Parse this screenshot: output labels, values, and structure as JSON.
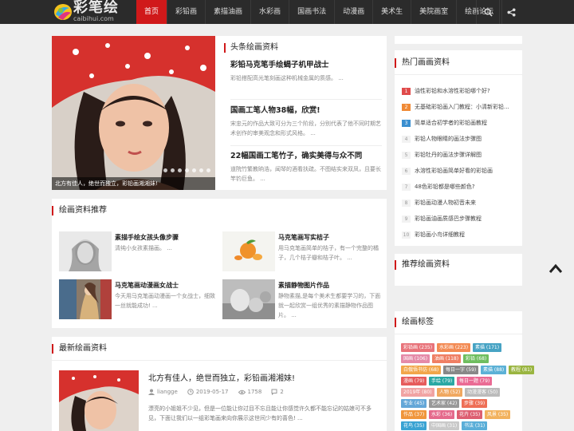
{
  "site": {
    "logo_text": "彩笔绘",
    "logo_sub": "caibihui.com"
  },
  "nav": {
    "items": [
      "首页",
      "彩铅画",
      "素描油画",
      "水彩画",
      "国画书法",
      "动漫画",
      "美术生",
      "美院画室",
      "绘画论坛"
    ],
    "active": 0
  },
  "colors": {
    "topbar": "#2b2b2b",
    "accent": "#d0191a"
  },
  "icons": {
    "search": "search-icon",
    "share": "share-icon",
    "backtop": "chevron-up-icon"
  },
  "headline": {
    "section_title": "头条绘画资料",
    "hero_caption": "北方有佳人，绝世而独立，彩铅画湘湘妹!",
    "items": [
      {
        "title": "彩铅马克笔手绘蝎子机甲战士",
        "desc": "彩铅搭配高光笔刻画这种机械金属的质感。 ..."
      },
      {
        "title": "国画工笔人物38幅，欣赏!",
        "desc": "宋忠元的作品大致可分为三个阶段，分别代表了他不同时期艺术创作的审美观念和形式风格。 ..."
      },
      {
        "title": "22幅国画工笔竹子，确实美得与众不同",
        "desc": "道院竹繁教晌浩，闻琴的酒看扶疏。不图结实来双凤，且要长竿钓巨鱼。 ..."
      }
    ]
  },
  "recommend": {
    "section_title": "绘画资料推荐",
    "items": [
      {
        "title": "素描手绘女孩头像步骤",
        "desc": "清纯小女孩素描画。 ..."
      },
      {
        "title": "马克笔画写实桔子",
        "desc": "用马克笔画简单的桔子，有一个完整的橘子，几个桔子瓣和桔子叶。 ..."
      },
      {
        "title": "马克笔画动漫画女战士",
        "desc": "今天用马克笔画动漫画一个女战士，细致一丝就能成功! ..."
      },
      {
        "title": "素描静物图片作品",
        "desc": "静物素描,是每个美术生都要学习的，下面就一起欣赏一组优秀的素描静物作品图片。 ..."
      }
    ]
  },
  "latest": {
    "section_title": "最新绘画资料",
    "item": {
      "title": "北方有佳人，绝世而独立，彩铅画湘湘妹!",
      "author": "liangge",
      "date": "2019-05-17",
      "views": "1758",
      "comments": "2",
      "desc": "漂亮的小姐姐不少见，但是一位能让你过目不忘且能让你感觉许久都不能忘记的姑娘可不多见，下面让我们以一组彩笔画来向你展示这世间少有的喜色! ..."
    }
  },
  "hot": {
    "section_title": "热门画画资料",
    "items": [
      {
        "rank": "1",
        "title": "油性彩铅和水溶性彩铅哪个好?"
      },
      {
        "rank": "2",
        "title": "无基础彩铅画入门教程：小清新彩铅..."
      },
      {
        "rank": "3",
        "title": "简单适合初学者的彩铅画教程"
      },
      {
        "rank": "4",
        "title": "彩铅人物眼睛的画法步骤图"
      },
      {
        "rank": "5",
        "title": "彩铅牡丹的画法步骤详解图"
      },
      {
        "rank": "6",
        "title": "水溶性彩铅画简单好看的彩铅画"
      },
      {
        "rank": "7",
        "title": "48色彩铅都是哪些颜色?"
      },
      {
        "rank": "8",
        "title": "彩铅画动漫人物初音未来"
      },
      {
        "rank": "9",
        "title": "彩铅画油画质感巴步骤教程"
      },
      {
        "rank": "10",
        "title": "彩铅画小鸟详细教程"
      }
    ]
  },
  "recommend_side": {
    "section_title": "推荐绘画资料"
  },
  "tags": {
    "section_title": "绘画标签",
    "items": [
      {
        "label": "彩铅画 (235)",
        "color": "#e8737a"
      },
      {
        "label": "水彩画 (223)",
        "color": "#f38b54"
      },
      {
        "label": "素描 (171)",
        "color": "#47a3c4"
      },
      {
        "label": "国画 (106)",
        "color": "#e58aa8"
      },
      {
        "label": "油画 (118)",
        "color": "#ef7f64"
      },
      {
        "label": "彩铅 (68)",
        "color": "#6fbe5f"
      },
      {
        "label": "白俄悟书仿 (68)",
        "color": "#f2a64a"
      },
      {
        "label": "每日一字 (59)",
        "color": "#888888"
      },
      {
        "label": "素描 (88)",
        "color": "#5cb1d6"
      },
      {
        "label": "教程 (81)",
        "color": "#9ab540"
      },
      {
        "label": "漫画 (79)",
        "color": "#e65b5b"
      },
      {
        "label": "手绘 (79)",
        "color": "#29a8a3"
      },
      {
        "label": "每日一题 (79)",
        "color": "#ea6b94"
      },
      {
        "label": "2019年 (80)",
        "color": "#f1a3a3"
      },
      {
        "label": "人物 (52)",
        "color": "#f0a860"
      },
      {
        "label": "动漫漫客 (50)",
        "color": "#bbbbbb"
      },
      {
        "label": "专业 (45)",
        "color": "#64a7d8"
      },
      {
        "label": "艺术家 (42)",
        "color": "#999999"
      },
      {
        "label": "步骤 (39)",
        "color": "#ee6f56"
      },
      {
        "label": "作品 (37)",
        "color": "#f0963c"
      },
      {
        "label": "水彩 (36)",
        "color": "#e56a8c"
      },
      {
        "label": "花卉 (35)",
        "color": "#dd5f71"
      },
      {
        "label": "风景 (35)",
        "color": "#f2b25d"
      },
      {
        "label": "花鸟 (35)",
        "color": "#3aa3d3"
      },
      {
        "label": "中国画 (31)",
        "color": "#c9c9c9"
      },
      {
        "label": "书法 (31)",
        "color": "#5aaed8"
      }
    ]
  }
}
